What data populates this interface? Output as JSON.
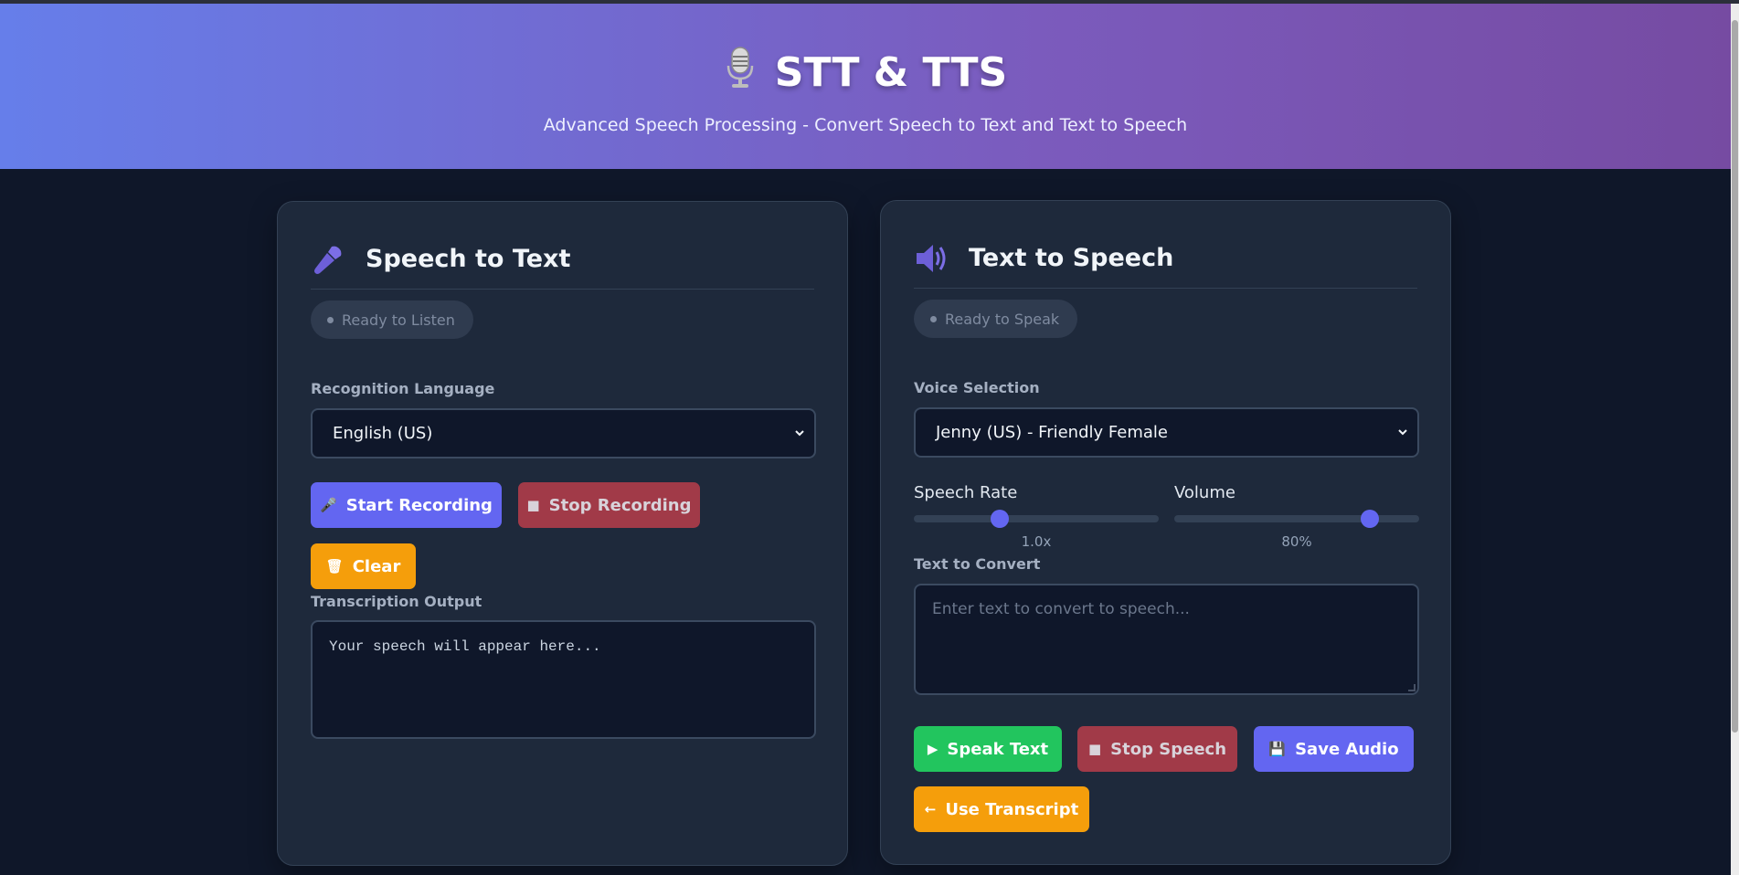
{
  "header": {
    "title": "STT & TTS",
    "subtitle": "Advanced Speech Processing - Convert Speech to Text and Text to Speech",
    "icon": "microphone-icon"
  },
  "stt": {
    "title": "Speech to Text",
    "icon": "microphone-icon",
    "status": "Ready to Listen",
    "language_label": "Recognition Language",
    "language_value": "English (US)",
    "start_label": "Start Recording",
    "stop_label": "Stop Recording",
    "clear_label": "Clear",
    "output_label": "Transcription Output",
    "output_placeholder": "Your speech will appear here..."
  },
  "tts": {
    "title": "Text to Speech",
    "icon": "speaker-icon",
    "status": "Ready to Speak",
    "voice_label": "Voice Selection",
    "voice_value": "Jenny (US) - Friendly Female",
    "rate_label": "Speech Rate",
    "rate_value": "1.0x",
    "rate_fraction": 0.35,
    "volume_label": "Volume",
    "volume_value": "80%",
    "volume_fraction": 0.8,
    "text_label": "Text to Convert",
    "text_placeholder": "Enter text to convert to speech...",
    "speak_label": "Speak Text",
    "stop_label": "Stop Speech",
    "save_label": "Save Audio",
    "use_transcript_label": "Use Transcript"
  },
  "colors": {
    "accent": "#6366f1",
    "danger": "#a13a48",
    "warning": "#f59e0b",
    "success": "#22c55e",
    "background": "#0f1729",
    "panel": "#1e293b"
  }
}
